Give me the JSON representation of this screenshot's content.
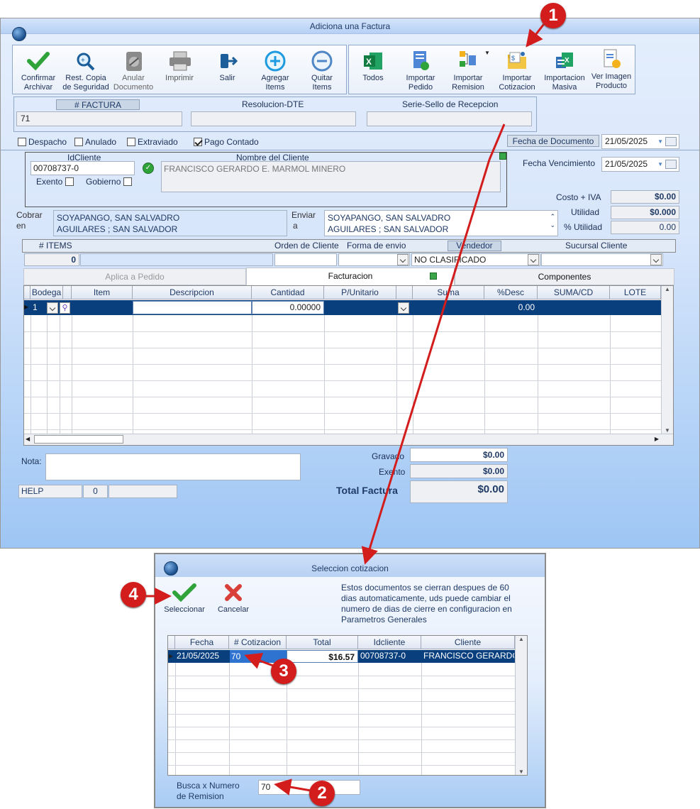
{
  "main_window": {
    "title": "Adiciona una Factura",
    "toolbar": [
      {
        "line1": "Confirmar",
        "line2": "Archivar",
        "icon": "check-icon"
      },
      {
        "line1": "Rest. Copia",
        "line2": "de Seguridad",
        "icon": "magnify-icon"
      },
      {
        "line1": "Anular",
        "line2": "Documento",
        "icon": "disk-icon"
      },
      {
        "line1": "Imprimir",
        "line2": "",
        "icon": "printer-icon"
      },
      {
        "line1": "Salir",
        "line2": "",
        "icon": "exit-icon"
      },
      {
        "line1": "Agregar",
        "line2": "Items",
        "icon": "plus-circle-icon"
      },
      {
        "line1": "Quitar",
        "line2": "Items",
        "icon": "minus-circle-icon"
      }
    ],
    "toolbar2": [
      {
        "line1": "Todos",
        "line2": "",
        "icon": "excel-icon"
      },
      {
        "line1": "Importar",
        "line2": "Pedido",
        "icon": "doc-check-icon"
      },
      {
        "line1": "Importar",
        "line2": "Remision",
        "icon": "flow-icon"
      },
      {
        "line1": "Importar",
        "line2": "Cotizacion",
        "icon": "folder-user-icon"
      },
      {
        "line1": "Importacion",
        "line2": "Masiva",
        "icon": "excel-multi-icon"
      },
      {
        "line1": "Ver Imagen",
        "line2": "Producto",
        "icon": "invoice-icon"
      }
    ],
    "factura": {
      "label": "# FACTURA",
      "value": "71",
      "resolucion_label": "Resolucion-DTE",
      "serie_label": "Serie-Sello de Recepcion"
    },
    "checks": {
      "despacho": "Despacho",
      "anulado": "Anulado",
      "extraviado": "Extraviado",
      "pago": "Pago Contado"
    },
    "fecha_doc_label": "Fecha de  Documento",
    "fecha_doc": "21/05/2025",
    "fecha_venc_label": "Fecha Vencimiento",
    "fecha_venc": "21/05/2025",
    "cliente": {
      "id_label": "IdCliente",
      "id": "00708737-0",
      "nombre_label": "Nombre del Cliente",
      "nombre": "FRANCISCO GERARDO E. MARMOL MINERO",
      "exento": "Exento",
      "gobierno": "Gobierno"
    },
    "totales_right": {
      "costo_label": "Costo + IVA",
      "costo": "$0.00",
      "utilidad_label": "Utilidad",
      "utilidad": "$0.000",
      "putil_label": "% Utilidad",
      "putil": "0.00"
    },
    "cobrar": {
      "label1": "Cobrar",
      "label2": "en",
      "line1": "SOYAPANGO, SAN SALVADRO",
      "line2": "AGUILARES ; SAN SALVADOR"
    },
    "enviar": {
      "label1": "Enviar",
      "label2": "a",
      "line1": "SOYAPANGO, SAN SALVADRO",
      "line2": "AGUILARES ; SAN SALVADOR"
    },
    "row2": {
      "items_label": "# ITEMS",
      "items": "0",
      "orden_label": "Orden de Cliente",
      "forma_label": "Forma de envio",
      "vendedor_label": "Vendedor",
      "vendedor": "NO CLASIFICADO",
      "sucursal_label": "Sucursal Cliente"
    },
    "tabs": [
      "Aplica a Pedido",
      "Facturacion",
      "Componentes"
    ],
    "grid": {
      "columns": [
        "Bodega",
        "",
        "Item",
        "Descripcion",
        "Cantidad",
        "P/Unitario",
        "",
        "Suma",
        "%Desc",
        "SUMA/CD",
        "LOTE"
      ],
      "row": {
        "bodega": "1",
        "cantidad": "0.00000",
        "desc": "0.00"
      }
    },
    "nota_label": "Nota:",
    "help": "HELP",
    "help_num": "0",
    "gravado_label": "Gravado",
    "gravado": "$0.00",
    "exento_label": "Exento",
    "exento": "$0.00",
    "total_label": "Total Factura",
    "total": "$0.00"
  },
  "dialog": {
    "title": "Seleccion cotizacion",
    "select_label": "Seleccionar",
    "cancel_label": "Cancelar",
    "info": [
      "Estos documentos se cierran despues de 60",
      "dias automaticamente, uds puede cambiar el",
      "numero de dias de cierre en configuracion en",
      "Parametros Generales"
    ],
    "columns": [
      "Fecha",
      "# Cotizacion",
      "Total",
      "Idcliente",
      "Cliente"
    ],
    "row": [
      "21/05/2025",
      "70",
      "$16.57",
      "00708737-0",
      "FRANCISCO GERARDO"
    ],
    "search_label1": "Busca x Numero",
    "search_label2": "de Remision",
    "search_value": "70"
  },
  "callouts": [
    "1",
    "2",
    "3",
    "4"
  ],
  "colors": {
    "callout": "#d31c1c",
    "selection": "#0a3f7e",
    "window_gradient_bottom": "#9ec6f4"
  }
}
